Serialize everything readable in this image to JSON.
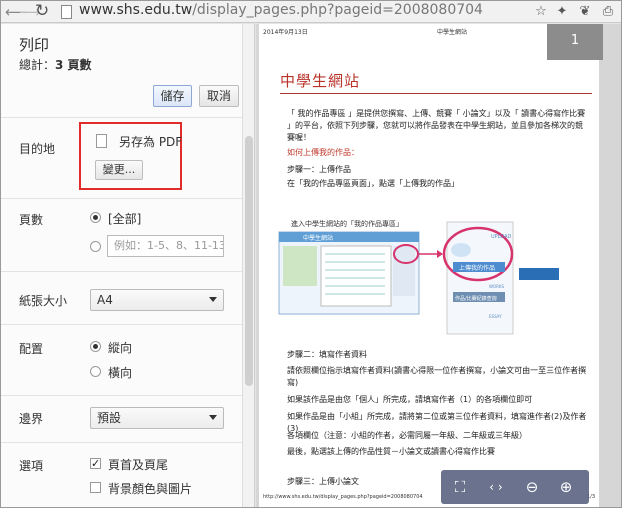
{
  "browser": {
    "url_host": "www.shs.edu.tw",
    "url_path": "/display_pages.php?pageid=2008080704"
  },
  "print_dialog": {
    "title": "列印",
    "total_label": "總計：",
    "total_value": "3 頁數",
    "save_button": "儲存",
    "cancel_button": "取消",
    "destination": {
      "label": "目的地",
      "value": "另存為 PDF",
      "change_button": "變更..."
    },
    "pages": {
      "label": "頁數",
      "all_option": "[全部]",
      "custom_placeholder": "例如：1-5、8、11-13"
    },
    "paper_size": {
      "label": "紙張大小",
      "value": "A4"
    },
    "layout": {
      "label": "配置",
      "portrait": "縱向",
      "landscape": "橫向"
    },
    "margins": {
      "label": "邊界",
      "value": "預設"
    },
    "options": {
      "label": "選項",
      "headers_footers": "頁首及頁尾",
      "headers_footers_checked": true,
      "background": "背景顏色與圖片",
      "background_checked": false
    }
  },
  "preview": {
    "header_date": "2014年9月13日",
    "header_title": "中學生網站",
    "site_title": "中學生網站",
    "para1": "「 我的作品專區 」是提供您撰寫、上傳、競賽「 小論文」以及「 讀書心得寫作比賽 」的平台，依照下列步驟，您就可以將作品發表在中學生網站，並且參加各梯次的競賽喔！",
    "how_upload": "如何上傳我的作品：",
    "step1": "步驟一：上傳作品",
    "step1_detail": "在「我的作品專區頁面」，點選「上傳我的作品」",
    "ill_caption": "進入中學生網站的「我的作品專區」",
    "ill_site": "中學生網站",
    "ill_upload": "UPLOAD",
    "ill_upload_btn": "上傳我的作品",
    "ill_works": "WORKS",
    "ill_works_btn": "作品/比賽紀錄查詢",
    "ill_essay": "ESSAY",
    "step2": "步驟二：填寫作者資料",
    "step2_line1": "請依照欄位指示填寫作者資料(讀書心得限一位作者撰寫，小論文可由一至三位作者撰寫)",
    "step2_line2": "如果該作品是由您「個人」所完成，請填寫作者（1）的各項欄位即可",
    "step2_line3": "如果作品是由「小組」所完成，請將第二位或第三位作者資料，填寫進作者(2)及作者(3)",
    "step2_line4": "各項欄位（注意：小組的作者，必需同屬一年級、二年級或三年級）",
    "step2_line5": "最後，點選該上傳的作品性質－小論文或讀書心得寫作比賽",
    "step3": "步驟三：上傳小論文",
    "footer_url": "http://www.shs.edu.tw/display_pages.php?pageid=2008080704",
    "page_badge": "1",
    "page_suffix": "1/3"
  },
  "icons": [
    "back-icon",
    "forward-icon",
    "reload-icon",
    "page-icon",
    "star-icon",
    "puzzle-icon",
    "evernote-icon",
    "print-icon",
    "pdf-file-icon",
    "fit-page-icon",
    "page-nav-icon",
    "zoom-out-icon",
    "zoom-in-icon"
  ]
}
